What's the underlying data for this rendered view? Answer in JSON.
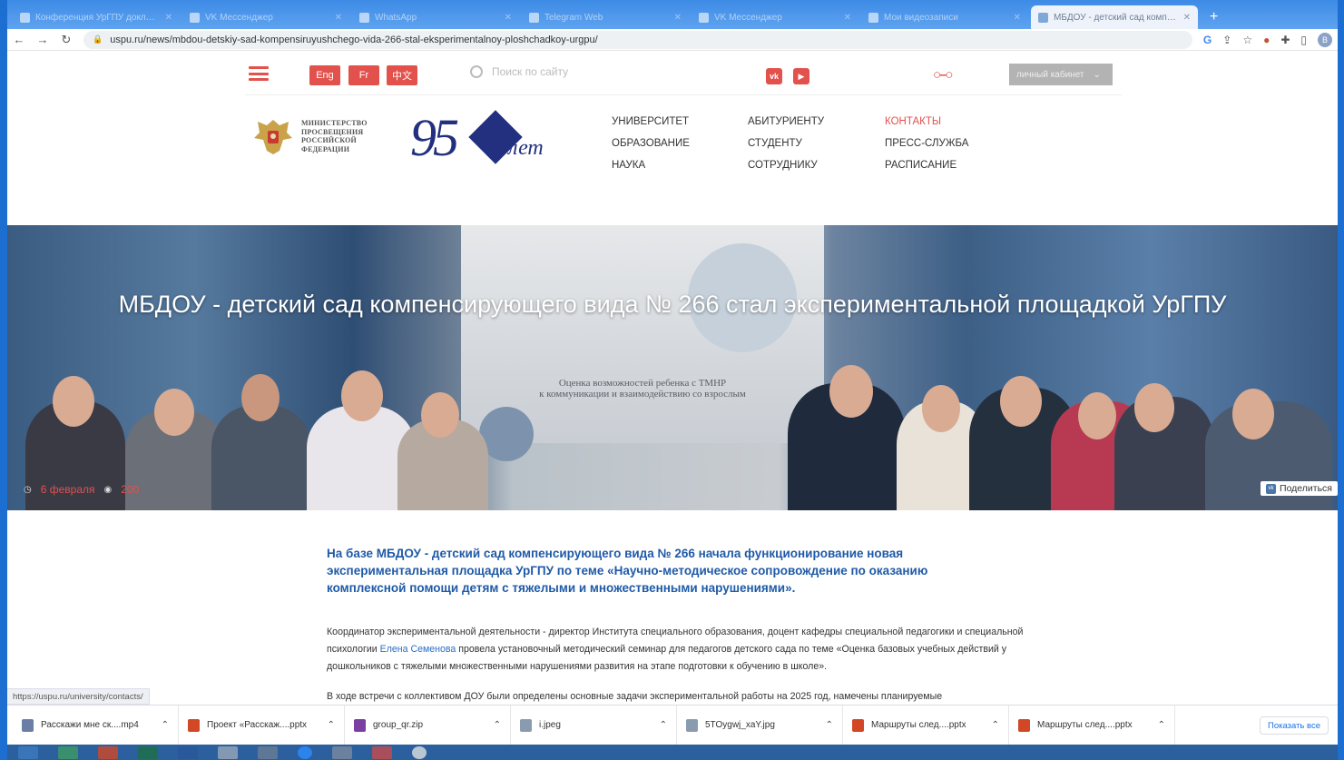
{
  "browser": {
    "tabs": [
      {
        "label": "Конференция УрГПУ доклад..."
      },
      {
        "label": "VK Мессенджер"
      },
      {
        "label": "WhatsApp"
      },
      {
        "label": "Telegram Web"
      },
      {
        "label": "VK Мессенджер"
      },
      {
        "label": "Мои видеозаписи"
      },
      {
        "label": "МБДОУ - детский сад компен...",
        "active": true
      }
    ],
    "url": "uspu.ru/news/mbdou-detskiy-sad-kompensiruyushchego-vida-266-stal-eksperimentalnoy-ploshchadkoy-urgpu/",
    "profile_initial": "В"
  },
  "site": {
    "languages": [
      "Eng",
      "Fr",
      "中文"
    ],
    "search_placeholder": "Поиск по сайту",
    "social": [
      "vk",
      "youtube"
    ],
    "cabinet_label": "личный кабинет",
    "ministry_lines": [
      "МИНИСТЕРСТВО",
      "ПРОСВЕЩЕНИЯ",
      "РОССИЙСКОЙ",
      "ФЕДЕРАЦИИ"
    ],
    "anniversary_number": "95",
    "anniversary_word": "лет",
    "menu_col1": [
      "УНИВЕРСИТЕТ",
      "ОБРАЗОВАНИЕ",
      "НАУКА"
    ],
    "menu_col2": [
      "АБИТУРИЕНТУ",
      "СТУДЕНТУ",
      "СОТРУДНИКУ"
    ],
    "menu_col3": [
      "КОНТАКТЫ",
      "ПРЕСС-СЛУЖБА",
      "РАСПИСАНИЕ"
    ],
    "accent_color": "#e2514c",
    "brand_blue": "#23307f"
  },
  "hero": {
    "title": "МБДОУ - детский сад компенсирующего вида № 266 стал экспериментальной площадкой УрГПУ",
    "slide_line1": "Оценка возможностей ребенка с ТМНР",
    "slide_line2": "к коммуникации и взаимодействию со взрослым",
    "date": "6 февраля",
    "views": "200",
    "share_label": "Поделиться"
  },
  "article": {
    "lead": "На базе МБДОУ - детский сад компенсирующего вида № 266 начала функционирование новая экспериментальная площадка УрГПУ по теме «Научно-методическое сопровождение по оказанию комплексной помощи детям с тяжелыми и множественными нарушениями».",
    "p1_before": "Координатор экспериментальной деятельности - директор Института специального образования, доцент кафедры специальной педагогики и специальной психологии ",
    "p1_link": "Елена Семенова",
    "p1_after": " провела установочный методический семинар для педагогов детского сада по теме «Оценка базовых учебных действий у дошкольников с тяжелыми множественными нарушениями развития на этапе подготовки к обучению в школе».",
    "p2": "В ходе встречи с коллективом ДОУ были определены основные задачи экспериментальной работы на 2025 год, намечены планируемые"
  },
  "status_url": "https://uspu.ru/university/contacts/",
  "downloads": {
    "items": [
      {
        "name": "Расскажи мне ск....mp4",
        "color": "#6b7fa6"
      },
      {
        "name": "Проект «Расскаж....pptx",
        "color": "#d24726"
      },
      {
        "name": "group_qr.zip",
        "color": "#7a3fa0"
      },
      {
        "name": "i.jpeg",
        "color": "#8a9bb0"
      },
      {
        "name": "5TOygwj_xaY.jpg",
        "color": "#8a9bb0"
      },
      {
        "name": "Маршруты след....pptx",
        "color": "#d24726"
      },
      {
        "name": "Маршруты след....pptx",
        "color": "#d24726"
      }
    ],
    "show_all": "Показать все"
  }
}
